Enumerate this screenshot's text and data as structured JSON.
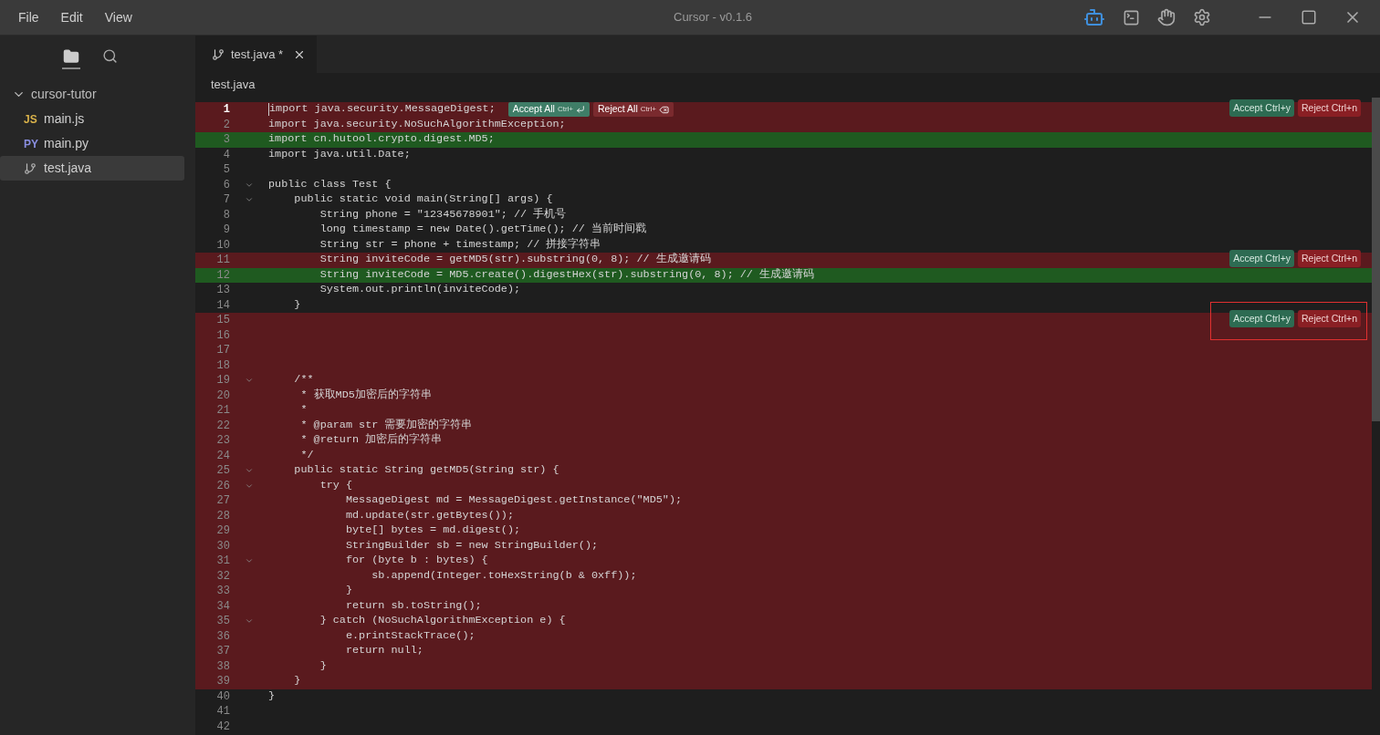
{
  "window": {
    "title": "Cursor - v0.1.6",
    "menus": [
      "File",
      "Edit",
      "View"
    ]
  },
  "sidebar": {
    "views": [
      {
        "kind": "files",
        "selected": true
      },
      {
        "kind": "search",
        "selected": false
      }
    ],
    "tree": [
      {
        "label": "cursor-tutor",
        "expanded": true,
        "children": [
          {
            "label": "main.js",
            "kind": "js",
            "badge": "JS",
            "selected": false
          },
          {
            "label": "main.py",
            "kind": "py",
            "badge": "PY",
            "selected": false
          },
          {
            "label": "test.java",
            "kind": "java",
            "selected": true
          }
        ]
      }
    ]
  },
  "tabs": [
    {
      "label": "test.java *",
      "selected": true
    }
  ],
  "breadcrumb": "test.java",
  "inline_actions": {
    "accept": "Accept All",
    "accept_key": "Ctrl+",
    "reject": "Reject All",
    "reject_key": "Ctrl+"
  },
  "lines": [
    {
      "number": "1",
      "text": "import java.security.MessageDigest;",
      "kind": "removed",
      "current": true,
      "fold": false,
      "actions": {
        "accept": "Accept Ctrl+y",
        "reject": "Reject Ctrl+n",
        "highlighted": false
      }
    },
    {
      "number": "2",
      "text": "import java.security.NoSuchAlgorithmException;",
      "kind": "removed",
      "current": false,
      "fold": false
    },
    {
      "number": "3",
      "text": "import cn.hutool.crypto.digest.MD5;",
      "kind": "added",
      "current": false,
      "fold": false
    },
    {
      "number": "4",
      "text": "import java.util.Date;",
      "kind": "context",
      "current": false,
      "fold": false
    },
    {
      "number": "5",
      "kind": "context",
      "current": false,
      "fold": false
    },
    {
      "number": "6",
      "text": "public class Test {",
      "kind": "context",
      "current": false,
      "fold": true
    },
    {
      "number": "7",
      "text": "    public static void main(String[] args) {",
      "kind": "context",
      "current": false,
      "fold": true
    },
    {
      "number": "8",
      "text": "        String phone = \"12345678901\"; // 手机号",
      "kind": "context",
      "current": false,
      "fold": false
    },
    {
      "number": "9",
      "text": "        long timestamp = new Date().getTime(); // 当前时间戳",
      "kind": "context",
      "current": false,
      "fold": false
    },
    {
      "number": "10",
      "text": "        String str = phone + timestamp; // 拼接字符串",
      "kind": "context",
      "current": false,
      "fold": false
    },
    {
      "number": "11",
      "text": "        String inviteCode = getMD5(str).substring(0, 8); // 生成邀请码",
      "kind": "removed",
      "current": false,
      "fold": false,
      "actions": {
        "accept": "Accept Ctrl+y",
        "reject": "Reject Ctrl+n",
        "highlighted": false
      }
    },
    {
      "number": "12",
      "text": "        String inviteCode = MD5.create().digestHex(str).substring(0, 8); // 生成邀请码",
      "kind": "added",
      "current": false,
      "fold": false
    },
    {
      "number": "13",
      "text": "        System.out.println(inviteCode);",
      "kind": "context",
      "current": false,
      "fold": false
    },
    {
      "number": "14",
      "text": "    }",
      "kind": "context",
      "current": false,
      "fold": false
    },
    {
      "number": "15",
      "kind": "removed",
      "current": false,
      "fold": false,
      "actions": {
        "accept": "Accept Ctrl+y",
        "reject": "Reject Ctrl+n",
        "highlighted": true
      }
    },
    {
      "number": "16",
      "kind": "removed",
      "current": false,
      "fold": false
    },
    {
      "number": "17",
      "kind": "removed",
      "current": false,
      "fold": false
    },
    {
      "number": "18",
      "kind": "removed",
      "current": false,
      "fold": false
    },
    {
      "number": "19",
      "text": "    /**",
      "kind": "removed",
      "current": false,
      "fold": true
    },
    {
      "number": "20",
      "text": "     * 获取MD5加密后的字符串",
      "kind": "removed",
      "current": false,
      "fold": false
    },
    {
      "number": "21",
      "text": "     *",
      "kind": "removed",
      "current": false,
      "fold": false
    },
    {
      "number": "22",
      "text": "     * @param str 需要加密的字符串",
      "kind": "removed",
      "current": false,
      "fold": false
    },
    {
      "number": "23",
      "text": "     * @return 加密后的字符串",
      "kind": "removed",
      "current": false,
      "fold": false
    },
    {
      "number": "24",
      "text": "     */",
      "kind": "removed",
      "current": false,
      "fold": false
    },
    {
      "number": "25",
      "text": "    public static String getMD5(String str) {",
      "kind": "removed",
      "current": false,
      "fold": true
    },
    {
      "number": "26",
      "text": "        try {",
      "kind": "removed",
      "current": false,
      "fold": true
    },
    {
      "number": "27",
      "text": "            MessageDigest md = MessageDigest.getInstance(\"MD5\");",
      "kind": "removed",
      "current": false,
      "fold": false
    },
    {
      "number": "28",
      "text": "            md.update(str.getBytes());",
      "kind": "removed",
      "current": false,
      "fold": false
    },
    {
      "number": "29",
      "text": "            byte[] bytes = md.digest();",
      "kind": "removed",
      "current": false,
      "fold": false
    },
    {
      "number": "30",
      "text": "            StringBuilder sb = new StringBuilder();",
      "kind": "removed",
      "current": false,
      "fold": false
    },
    {
      "number": "31",
      "text": "            for (byte b : bytes) {",
      "kind": "removed",
      "current": false,
      "fold": true
    },
    {
      "number": "32",
      "text": "                sb.append(Integer.toHexString(b & 0xff));",
      "kind": "removed",
      "current": false,
      "fold": false
    },
    {
      "number": "33",
      "text": "            }",
      "kind": "removed",
      "current": false,
      "fold": false
    },
    {
      "number": "34",
      "text": "            return sb.toString();",
      "kind": "removed",
      "current": false,
      "fold": false
    },
    {
      "number": "35",
      "text": "        } catch (NoSuchAlgorithmException e) {",
      "kind": "removed",
      "current": false,
      "fold": true
    },
    {
      "number": "36",
      "text": "            e.printStackTrace();",
      "kind": "removed",
      "current": false,
      "fold": false
    },
    {
      "number": "37",
      "text": "            return null;",
      "kind": "removed",
      "current": false,
      "fold": false
    },
    {
      "number": "38",
      "text": "        }",
      "kind": "removed",
      "current": false,
      "fold": false
    },
    {
      "number": "39",
      "text": "    }",
      "kind": "removed",
      "current": false,
      "fold": false
    },
    {
      "number": "40",
      "text": "}",
      "kind": "context",
      "current": false,
      "fold": false
    },
    {
      "number": "41",
      "kind": "context",
      "current": false,
      "fold": false
    },
    {
      "number": "42",
      "kind": "context",
      "current": false,
      "fold": false
    }
  ]
}
